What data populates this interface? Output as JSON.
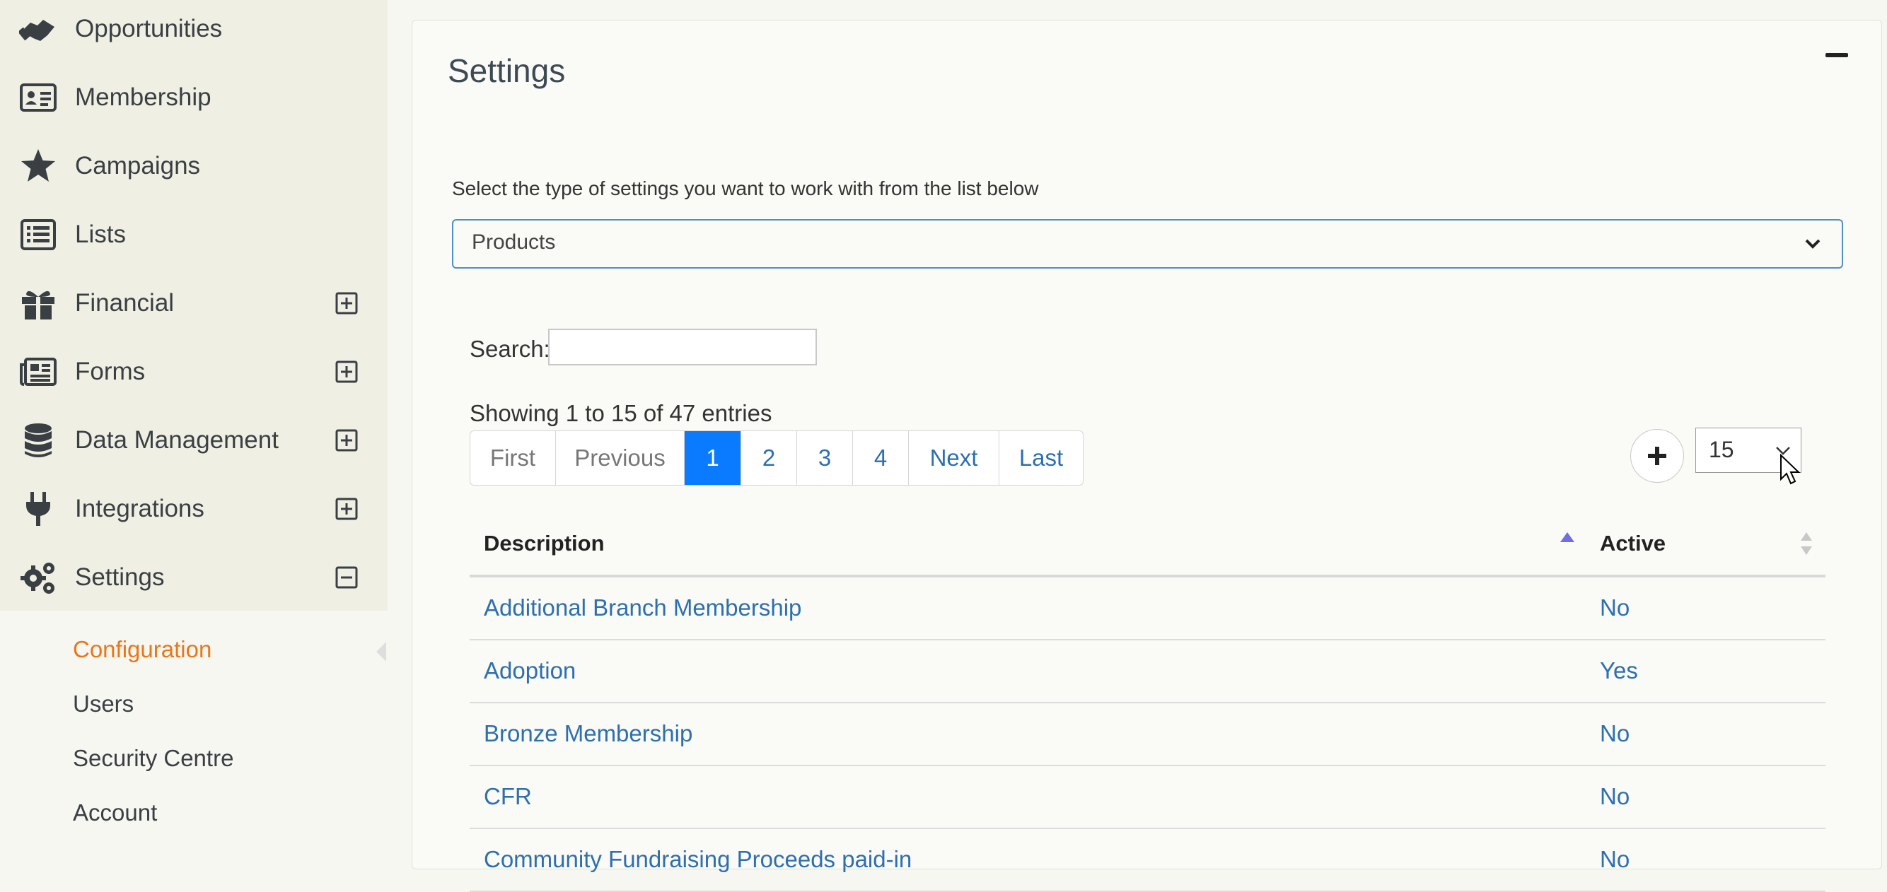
{
  "sidebar": {
    "items": [
      {
        "label": "Opportunities",
        "icon": "handshake-icon"
      },
      {
        "label": "Membership",
        "icon": "id-card-icon"
      },
      {
        "label": "Campaigns",
        "icon": "star-icon"
      },
      {
        "label": "Lists",
        "icon": "list-icon"
      },
      {
        "label": "Financial",
        "icon": "gift-icon",
        "toggle": "expand"
      },
      {
        "label": "Forms",
        "icon": "newspaper-icon",
        "toggle": "expand"
      },
      {
        "label": "Data Management",
        "icon": "database-icon",
        "toggle": "expand"
      },
      {
        "label": "Integrations",
        "icon": "plug-icon",
        "toggle": "expand"
      },
      {
        "label": "Settings",
        "icon": "gears-icon",
        "toggle": "collapse"
      }
    ],
    "settings_submenu": [
      {
        "label": "Configuration",
        "active": true
      },
      {
        "label": "Users"
      },
      {
        "label": "Security Centre"
      },
      {
        "label": "Account"
      }
    ]
  },
  "panel": {
    "title": "Settings",
    "intro": "Select the type of settings you want to work with from the list below",
    "settings_type": {
      "value": "Products"
    },
    "search": {
      "label": "Search:",
      "value": ""
    },
    "info": "Showing 1 to 15 of 47 entries",
    "pagination": {
      "first": "First",
      "previous": "Previous",
      "pages": [
        "1",
        "2",
        "3",
        "4"
      ],
      "current": "1",
      "next": "Next",
      "last": "Last"
    },
    "page_length": "15",
    "table": {
      "columns": [
        "Description",
        "Active"
      ],
      "rows": [
        [
          "Additional Branch Membership",
          "No"
        ],
        [
          "Adoption",
          "Yes"
        ],
        [
          "Bronze Membership",
          "No"
        ],
        [
          "CFR",
          "No"
        ],
        [
          "Community Fundraising Proceeds paid-in",
          "No"
        ]
      ]
    }
  },
  "colors": {
    "accent_active": "#e8761b",
    "link": "#2e6fb0",
    "page_current": "#0a7bff",
    "sidebar_bg": "#efefe3"
  }
}
